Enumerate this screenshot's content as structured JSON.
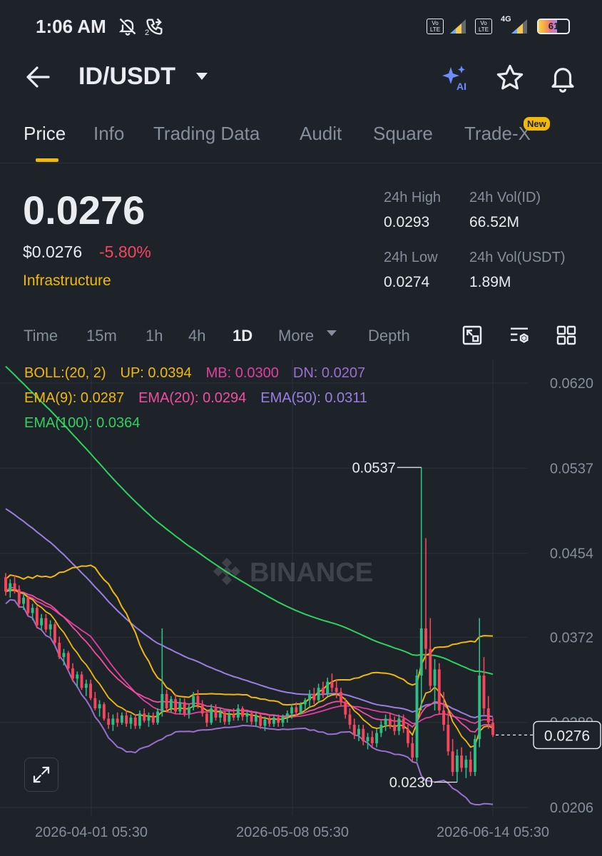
{
  "status": {
    "time": "1:06 AM",
    "call_count": "2",
    "volte1": "Vo LTE",
    "volte2": "Vo LTE",
    "network": "4G",
    "battery": "61"
  },
  "header": {
    "title": "ID/USDT",
    "ai_label": "AI"
  },
  "tabs": [
    {
      "label": "Price"
    },
    {
      "label": "Info"
    },
    {
      "label": "Trading Data"
    },
    {
      "label": "Audit"
    },
    {
      "label": "Square"
    },
    {
      "label": "Trade-X"
    }
  ],
  "new_badge": "New",
  "price": {
    "last": "0.0276",
    "usd": "$0.0276",
    "change": "-5.80%",
    "category": "Infrastructure"
  },
  "stats": {
    "high_label": "24h High",
    "high_value": "0.0293",
    "vol_id_label": "24h Vol(ID)",
    "vol_id_value": "66.52M",
    "low_label": "24h Low",
    "low_value": "0.0274",
    "vol_usdt_label": "24h Vol(USDT)",
    "vol_usdt_value": "1.89M"
  },
  "intervals": {
    "time": "Time",
    "m15": "15m",
    "h1": "1h",
    "h4": "4h",
    "d1": "1D",
    "more": "More",
    "depth": "Depth"
  },
  "indicators": {
    "boll": "BOLL:(20, 2)",
    "up": "UP: 0.0394",
    "mb": "MB: 0.0300",
    "dn": "DN: 0.0207",
    "ema9": "EMA(9): 0.0287",
    "ema20": "EMA(20): 0.0294",
    "ema50": "EMA(50): 0.0311",
    "ema100": "EMA(100): 0.0364"
  },
  "colors": {
    "up": "#2ebd85",
    "down": "#f6465d",
    "accent": "#f0b90b",
    "boll_up": "#f0b90b",
    "boll_mb": "#e040a0",
    "boll_dn": "#9a6fd0",
    "ema9": "#f0b90b",
    "ema20": "#f04fa0",
    "ema50": "#9b7fe0",
    "ema100": "#31d160"
  },
  "watermark": "BINANCE",
  "chart_data": {
    "type": "candlestick",
    "y_ticks": [
      "0.0620",
      "0.0537",
      "0.0454",
      "0.0372",
      "0.0289",
      "0.0206"
    ],
    "y_tick_values": [
      0.062,
      0.0537,
      0.0454,
      0.0372,
      0.0289,
      0.0206
    ],
    "x_ticks": [
      "2026-04-01 05:30",
      "2026-05-08 05:30",
      "2026-06-14 05:30"
    ],
    "last_price_label": "0.0276",
    "last_price": 0.0276,
    "high_marker_label": "0.0537",
    "high_marker_value": 0.0537,
    "low_marker_label": "0.0230",
    "low_marker_value": 0.023,
    "ylim": [
      0.0206,
      0.062
    ],
    "candles": [
      [
        0.043,
        0.0434,
        0.0412,
        0.0416
      ],
      [
        0.0416,
        0.0428,
        0.041,
        0.0424
      ],
      [
        0.0424,
        0.0432,
        0.0414,
        0.0418
      ],
      [
        0.0418,
        0.0422,
        0.04,
        0.0404
      ],
      [
        0.0404,
        0.0414,
        0.0398,
        0.041
      ],
      [
        0.041,
        0.0412,
        0.0392,
        0.0395
      ],
      [
        0.0395,
        0.0404,
        0.0388,
        0.04
      ],
      [
        0.04,
        0.0402,
        0.038,
        0.0383
      ],
      [
        0.0383,
        0.0394,
        0.0378,
        0.039
      ],
      [
        0.039,
        0.0394,
        0.0376,
        0.0379
      ],
      [
        0.0379,
        0.0388,
        0.0372,
        0.0384
      ],
      [
        0.0384,
        0.0386,
        0.0364,
        0.0366
      ],
      [
        0.0366,
        0.0372,
        0.035,
        0.0352
      ],
      [
        0.0352,
        0.036,
        0.0344,
        0.0356
      ],
      [
        0.0356,
        0.0358,
        0.0338,
        0.0341
      ],
      [
        0.0341,
        0.0346,
        0.0328,
        0.0331
      ],
      [
        0.0331,
        0.0338,
        0.0322,
        0.0335
      ],
      [
        0.0335,
        0.0338,
        0.032,
        0.0322
      ],
      [
        0.0322,
        0.033,
        0.0314,
        0.0326
      ],
      [
        0.0326,
        0.033,
        0.031,
        0.0312
      ],
      [
        0.0312,
        0.0318,
        0.03,
        0.0302
      ],
      [
        0.0302,
        0.031,
        0.0294,
        0.0306
      ],
      [
        0.0306,
        0.0308,
        0.029,
        0.0292
      ],
      [
        0.0292,
        0.0298,
        0.0282,
        0.0286
      ],
      [
        0.0286,
        0.0296,
        0.028,
        0.0292
      ],
      [
        0.0292,
        0.0298,
        0.0284,
        0.0288
      ],
      [
        0.0288,
        0.0298,
        0.0286,
        0.0295
      ],
      [
        0.0295,
        0.03,
        0.0284,
        0.0287
      ],
      [
        0.0287,
        0.0296,
        0.0282,
        0.0293
      ],
      [
        0.0293,
        0.0296,
        0.0282,
        0.0285
      ],
      [
        0.0285,
        0.03,
        0.0282,
        0.0297
      ],
      [
        0.0297,
        0.0302,
        0.0288,
        0.029
      ],
      [
        0.029,
        0.0298,
        0.0284,
        0.0295
      ],
      [
        0.0295,
        0.0298,
        0.0286,
        0.0288
      ],
      [
        0.0288,
        0.0302,
        0.0286,
        0.0299
      ],
      [
        0.0299,
        0.038,
        0.0294,
        0.0316
      ],
      [
        0.0316,
        0.032,
        0.0298,
        0.0302
      ],
      [
        0.0302,
        0.0314,
        0.0298,
        0.0311
      ],
      [
        0.0311,
        0.0316,
        0.0296,
        0.0299
      ],
      [
        0.0299,
        0.0312,
        0.0296,
        0.0308
      ],
      [
        0.0308,
        0.0312,
        0.0294,
        0.0297
      ],
      [
        0.0297,
        0.0306,
        0.0292,
        0.0303
      ],
      [
        0.0303,
        0.0318,
        0.03,
        0.0314
      ],
      [
        0.0314,
        0.032,
        0.0302,
        0.0305
      ],
      [
        0.0305,
        0.031,
        0.0294,
        0.0297
      ],
      [
        0.0297,
        0.03,
        0.0284,
        0.0288
      ],
      [
        0.0288,
        0.0306,
        0.0286,
        0.0302
      ],
      [
        0.0302,
        0.0306,
        0.029,
        0.0293
      ],
      [
        0.0293,
        0.0302,
        0.0288,
        0.0298
      ],
      [
        0.0298,
        0.03,
        0.0286,
        0.0289
      ],
      [
        0.0289,
        0.03,
        0.0286,
        0.0296
      ],
      [
        0.0296,
        0.0302,
        0.029,
        0.0293
      ],
      [
        0.0293,
        0.0306,
        0.029,
        0.0302
      ],
      [
        0.0302,
        0.0304,
        0.029,
        0.0294
      ],
      [
        0.0294,
        0.03,
        0.0288,
        0.0297
      ],
      [
        0.0297,
        0.03,
        0.0286,
        0.0289
      ],
      [
        0.0289,
        0.0298,
        0.0284,
        0.0295
      ],
      [
        0.0295,
        0.0298,
        0.0282,
        0.0285
      ],
      [
        0.0285,
        0.0294,
        0.028,
        0.0291
      ],
      [
        0.0291,
        0.0296,
        0.0284,
        0.0287
      ],
      [
        0.0287,
        0.0296,
        0.0284,
        0.0293
      ],
      [
        0.0293,
        0.0296,
        0.0284,
        0.0288
      ],
      [
        0.0288,
        0.0296,
        0.0284,
        0.0294
      ],
      [
        0.0294,
        0.03,
        0.0288,
        0.0297
      ],
      [
        0.0297,
        0.0306,
        0.0292,
        0.0303
      ],
      [
        0.0303,
        0.0308,
        0.0294,
        0.0298
      ],
      [
        0.0298,
        0.0308,
        0.0296,
        0.0306
      ],
      [
        0.0306,
        0.0312,
        0.03,
        0.031
      ],
      [
        0.031,
        0.032,
        0.0304,
        0.0316
      ],
      [
        0.0316,
        0.0322,
        0.0306,
        0.031
      ],
      [
        0.031,
        0.0326,
        0.0308,
        0.0322
      ],
      [
        0.0322,
        0.0328,
        0.0312,
        0.0316
      ],
      [
        0.0316,
        0.0332,
        0.0314,
        0.0328
      ],
      [
        0.0328,
        0.0336,
        0.0318,
        0.0322
      ],
      [
        0.0322,
        0.033,
        0.0312,
        0.0318
      ],
      [
        0.0318,
        0.0322,
        0.0304,
        0.0308
      ],
      [
        0.0308,
        0.0312,
        0.0292,
        0.0296
      ],
      [
        0.0296,
        0.0302,
        0.0282,
        0.0286
      ],
      [
        0.0286,
        0.0292,
        0.0272,
        0.0276
      ],
      [
        0.0276,
        0.0286,
        0.027,
        0.0282
      ],
      [
        0.0282,
        0.0286,
        0.0266,
        0.027
      ],
      [
        0.027,
        0.0278,
        0.0262,
        0.0274
      ],
      [
        0.0274,
        0.028,
        0.0264,
        0.0268
      ],
      [
        0.0268,
        0.0282,
        0.0264,
        0.0278
      ],
      [
        0.0278,
        0.029,
        0.0274,
        0.0286
      ],
      [
        0.0286,
        0.0296,
        0.028,
        0.0292
      ],
      [
        0.0292,
        0.0298,
        0.0282,
        0.0286
      ],
      [
        0.0286,
        0.0294,
        0.0276,
        0.028
      ],
      [
        0.028,
        0.0296,
        0.0276,
        0.0292
      ],
      [
        0.0292,
        0.0296,
        0.0278,
        0.0282
      ],
      [
        0.0282,
        0.0286,
        0.0264,
        0.0268
      ],
      [
        0.0268,
        0.0274,
        0.025,
        0.0254
      ],
      [
        0.0254,
        0.034,
        0.025,
        0.0334
      ],
      [
        0.0334,
        0.0537,
        0.03,
        0.038
      ],
      [
        0.038,
        0.0468,
        0.034,
        0.036
      ],
      [
        0.036,
        0.039,
        0.032,
        0.0324
      ],
      [
        0.0324,
        0.035,
        0.03,
        0.034
      ],
      [
        0.034,
        0.0346,
        0.0296,
        0.03
      ],
      [
        0.03,
        0.0318,
        0.028,
        0.0286
      ],
      [
        0.0286,
        0.03,
        0.0256,
        0.026
      ],
      [
        0.026,
        0.0272,
        0.0236,
        0.024
      ],
      [
        0.024,
        0.0262,
        0.023,
        0.0256
      ],
      [
        0.0256,
        0.0264,
        0.024,
        0.0244
      ],
      [
        0.0244,
        0.0256,
        0.0234,
        0.0252
      ],
      [
        0.0252,
        0.026,
        0.0236,
        0.024
      ],
      [
        0.024,
        0.0276,
        0.0236,
        0.0272
      ],
      [
        0.0272,
        0.039,
        0.0264,
        0.0334
      ],
      [
        0.0334,
        0.0352,
        0.0296,
        0.0302
      ],
      [
        0.0302,
        0.0314,
        0.0282,
        0.0288
      ],
      [
        0.0288,
        0.0293,
        0.0274,
        0.0276
      ]
    ]
  }
}
